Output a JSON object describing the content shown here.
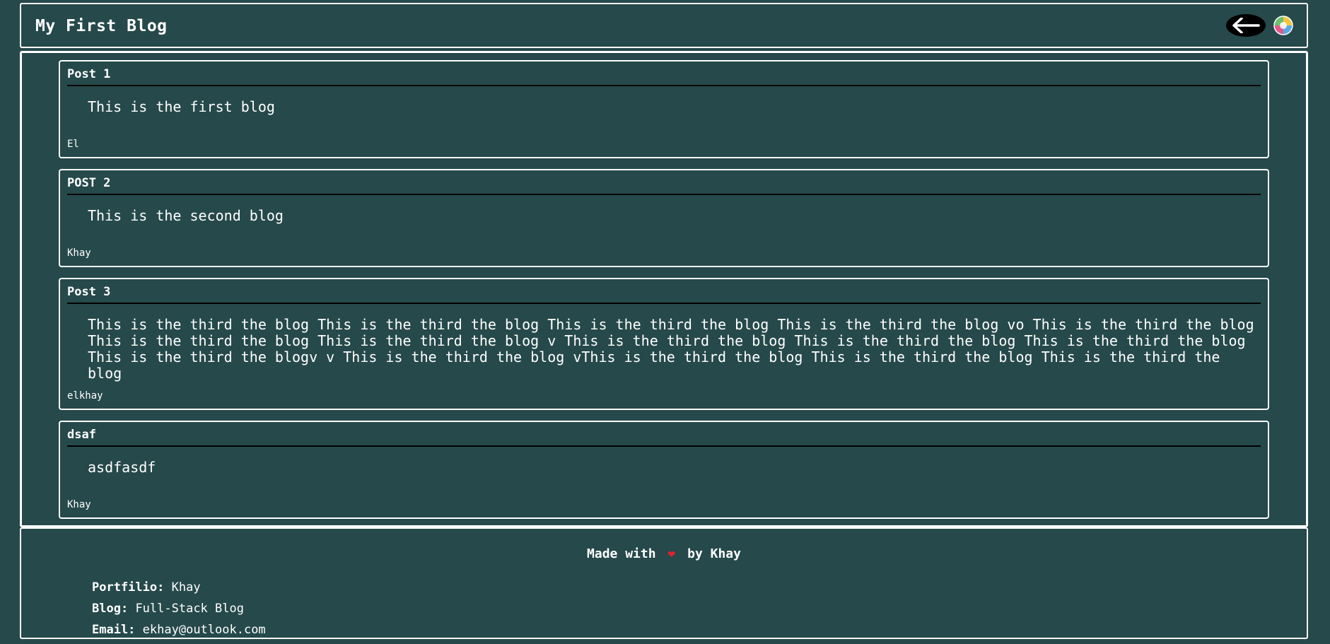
{
  "header": {
    "title": "My First Blog"
  },
  "posts": [
    {
      "title": "Post 1",
      "body": "This is the first blog",
      "author": "El"
    },
    {
      "title": "POST 2",
      "body": "This is the second blog",
      "author": "Khay"
    },
    {
      "title": "Post 3",
      "body": "This is the third the blog This is the third the blog This is the third the blog This is the third the blog vo This is the third the blog\nThis is the third the blog This is the third the blog v This is the third the blog This is the third the blog This is the third the blog\nThis is the third the blogv v This is the third the blog vThis is the third the blog This is the third the blog This is the third the blog",
      "author": "elkhay"
    },
    {
      "title": "dsaf",
      "body": "asdfasdf",
      "author": "Khay"
    }
  ],
  "footer": {
    "made_prefix": "Made with",
    "heart": "❤",
    "made_suffix": "by Khay",
    "portfolio_label": "Portfilio:",
    "portfolio_value": "Khay",
    "blog_label": "Blog:",
    "blog_value": "Full-Stack Blog",
    "email_label": "Email:",
    "email_value": "ekhay@outlook.com"
  },
  "icons": {
    "back": "arrow-left-icon",
    "globe": "globe-icon"
  },
  "colors": {
    "background": "#26494b",
    "text": "#ffffff",
    "heart": "#e0242a"
  }
}
